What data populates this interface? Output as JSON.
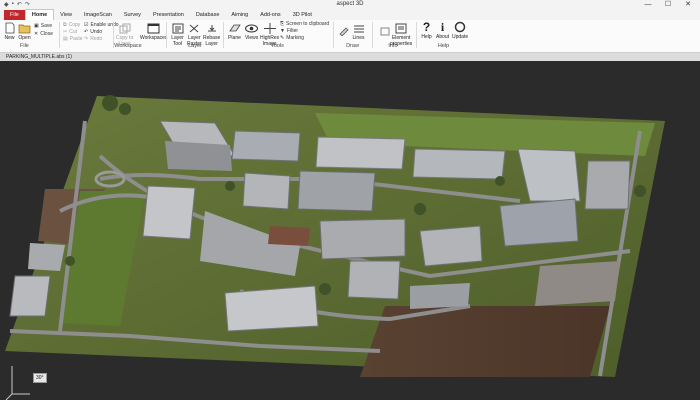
{
  "app": {
    "title": "aspect 3D"
  },
  "window": {
    "minimize": "—",
    "maximize": "☐",
    "close": "✕"
  },
  "tabs": [
    "File",
    "Home",
    "View",
    "ImageScan",
    "Survey",
    "Presentation",
    "Database",
    "Aiming",
    "Add-ons",
    "3D Pilot"
  ],
  "ribbon": {
    "file": {
      "new": "New",
      "open": "Open",
      "save": "Save",
      "close": "Close",
      "group": "File"
    },
    "clipboard": {
      "copy": "Copy",
      "cut": "Cut",
      "paste": "Paste",
      "enable_undo": "Enable undo",
      "undo": "Undo",
      "redo": "Redo"
    },
    "workspace": {
      "copy_to_layer": "Copy to\nLayer",
      "workspaces": "Workspaces",
      "group": "Workspace"
    },
    "layer": {
      "layer_tool": "Layer\nTool",
      "layer_rasterize": "Layer\nRaster",
      "rebase_layer": "Rebase\nLayer",
      "group": "Layer"
    },
    "tools": {
      "plane": "Plane",
      "views": "Views",
      "highres": "HighRes\nImage",
      "screen_to_clipboard": "Screen to clipboard",
      "filter": "Filter",
      "marking": "Marking",
      "group": "Tools"
    },
    "draw": {
      "lines": "Lines",
      "group": "Draw"
    },
    "info": {
      "element_properties": "Element\nproperties",
      "group": "Info"
    },
    "help": {
      "help": "Help",
      "about": "About",
      "update": "Update",
      "group": "Help"
    }
  },
  "document": {
    "tab_label": "PARKING_MULTIPLE.abs (1)"
  },
  "viewport": {
    "angle_label": "30°"
  }
}
